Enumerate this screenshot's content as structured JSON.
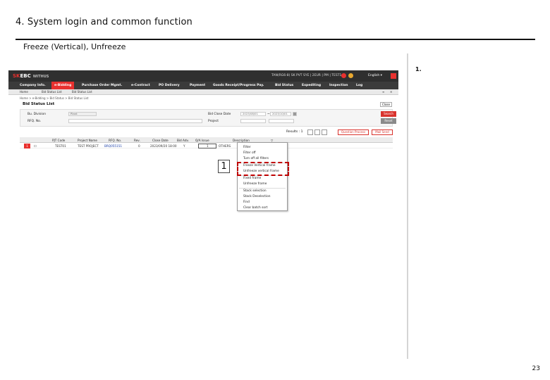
{
  "slide": {
    "title": "4. System login and common function",
    "subtitle": "Freeze (Vertical), Unfreeze",
    "step_label": "1.",
    "page_number": "23",
    "callout_number": "1",
    "highlight_color": "#c00000"
  },
  "app": {
    "logo_sk": "SK",
    "logo_ebc": "EBC",
    "logo_withus": "WITHUS",
    "user_info": "TAN(RG6-8) SK PVT SYE | 2EUR | PM | TEST1 |",
    "language": "English",
    "accent_color": "#e8312f"
  },
  "menu": [
    {
      "label": "Company Info.",
      "active": false
    },
    {
      "label": "e-Bidding",
      "active": true
    },
    {
      "label": "Purchase Order Mgmt.",
      "active": false
    },
    {
      "label": "e-Contract",
      "active": false
    },
    {
      "label": "PO Delivery",
      "active": false
    },
    {
      "label": "Payment",
      "active": false
    },
    {
      "label": "Goods Receipt/Progress Pay.",
      "active": false
    },
    {
      "label": "Bid Status",
      "active": false
    },
    {
      "label": "Expediting",
      "active": false
    },
    {
      "label": "Inspection",
      "active": false
    },
    {
      "label": "Log",
      "active": false
    }
  ],
  "tabs": [
    "Home",
    "Bid Status List",
    "Bid Status List"
  ],
  "breadcrumb": "Home > e-Bidding > Bid Status > Bid Status List",
  "page": {
    "title": "Bid Status List",
    "close_label": "Close"
  },
  "search": {
    "bu_division_label": "Bu. Division",
    "bu_division_value": "Plant",
    "rfq_no_label": "RFQ. No.",
    "bid_close_date_label": "Bid Close Date",
    "date_from": "2023/08/01",
    "date_to": "2023/10/01",
    "project_label": "Project",
    "search_label": "Search",
    "reset_label": "Reset"
  },
  "results": {
    "label": "Results : 1",
    "question_process_label": "Question Process",
    "mail_send_label": "Mail Send"
  },
  "grid": {
    "columns": [
      "PJT Code",
      "Project Name",
      "RFQ. No.",
      "Rev.",
      "Close Date",
      "Bid Adv.",
      "Q/A Issue",
      "Description"
    ],
    "rows": [
      {
        "no": "1",
        "pjt_code": "TEST01",
        "project_name": "TEST PROJECT",
        "rfq_no": "BRQ055151",
        "rev": "0",
        "close_date": "2023/09/20 18:00",
        "bid_adv": "Y",
        "qa_issue": "1",
        "description": "OTHERS"
      }
    ]
  },
  "context_menu": {
    "items": [
      "Filter",
      "Filter off",
      "Turn off all filters",
      "Freeze Vertical frame",
      "Unfreeze vertical frame",
      "Fixed frame",
      "Unfreeze frame",
      "Stack selection",
      "Stack Deselection",
      "Find",
      "Clear batch sort"
    ]
  }
}
